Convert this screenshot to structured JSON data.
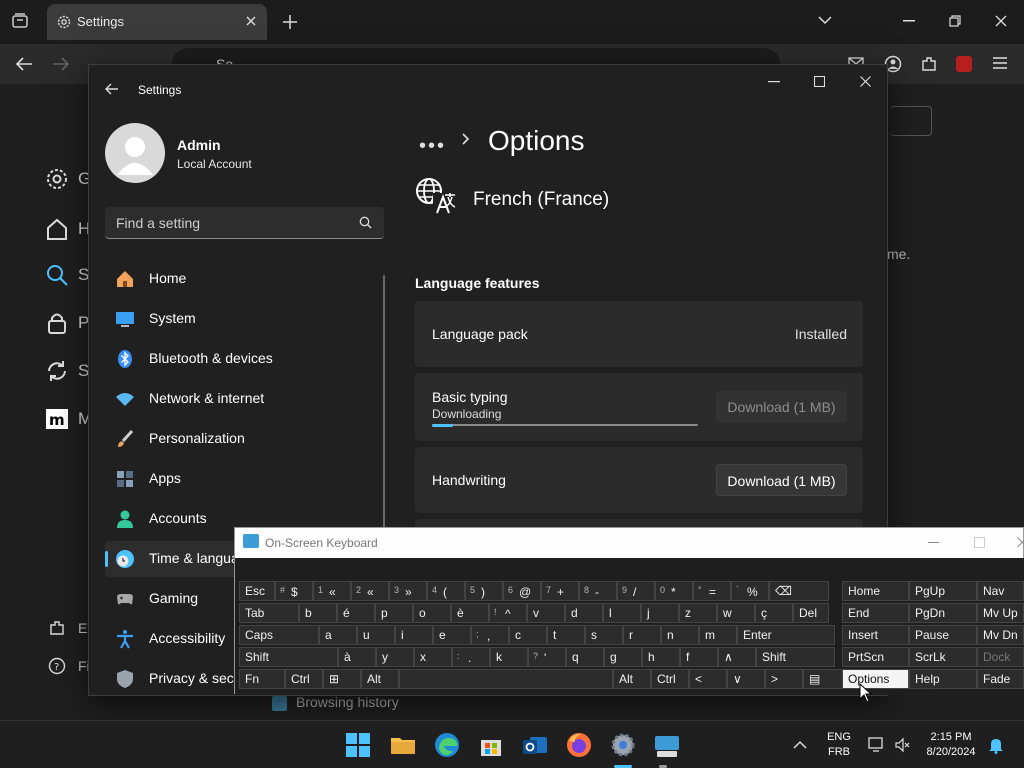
{
  "browser": {
    "tab_title": "Settings",
    "address_text": "Se",
    "bg_nav": [
      {
        "icon": "gear-icon",
        "label": "G"
      },
      {
        "icon": "home-icon",
        "label": "H"
      },
      {
        "icon": "search-icon",
        "label": "S"
      },
      {
        "icon": "lock-icon",
        "label": "P"
      },
      {
        "icon": "sync-icon",
        "label": "S"
      },
      {
        "icon": "m-logo-icon",
        "label": "M"
      }
    ],
    "bg_bottom": [
      {
        "icon": "extensions-icon",
        "label": "Ex"
      },
      {
        "icon": "help-icon",
        "label": "Fi"
      }
    ],
    "bg_partial_text": "me.",
    "bg_checkbox_label": "Browsing history"
  },
  "settings": {
    "window_title": "Settings",
    "user": {
      "name": "Admin",
      "type": "Local Account"
    },
    "search_placeholder": "Find a setting",
    "nav": [
      {
        "label": "Home",
        "icon": "home-icon",
        "color": "#f2a35b",
        "selected": false
      },
      {
        "label": "System",
        "icon": "monitor-icon",
        "color": "#3aa0f3",
        "selected": false
      },
      {
        "label": "Bluetooth & devices",
        "icon": "bluetooth-icon",
        "color": "#3a8ef3",
        "selected": false
      },
      {
        "label": "Network & internet",
        "icon": "wifi-icon",
        "color": "#5ab8f5",
        "selected": false
      },
      {
        "label": "Personalization",
        "icon": "brush-icon",
        "color": "#e8a260",
        "selected": false
      },
      {
        "label": "Apps",
        "icon": "apps-icon",
        "color": "#8aa0b8",
        "selected": false
      },
      {
        "label": "Accounts",
        "icon": "person-icon",
        "color": "#35c79a",
        "selected": false
      },
      {
        "label": "Time & language",
        "icon": "clock-globe-icon",
        "color": "#4cc2ff",
        "selected": true
      },
      {
        "label": "Gaming",
        "icon": "gamepad-icon",
        "color": "#a7a7a7",
        "selected": false
      },
      {
        "label": "Accessibility",
        "icon": "accessibility-icon",
        "color": "#3a9ff5",
        "selected": false
      },
      {
        "label": "Privacy & security",
        "icon": "shield-icon",
        "color": "#9ba3ad",
        "selected": false
      }
    ],
    "breadcrumb_dots": "•••",
    "page_title": "Options",
    "language_name": "French (France)",
    "section_header": "Language features",
    "cards": {
      "language_pack": {
        "label": "Language pack",
        "status": "Installed"
      },
      "basic_typing": {
        "label": "Basic typing",
        "sublabel": "Downloading",
        "progress": 0.08,
        "button": "Download (1 MB)"
      },
      "handwriting": {
        "label": "Handwriting",
        "button": "Download (1 MB)"
      }
    }
  },
  "osk": {
    "title": "On-Screen Keyboard",
    "rows": [
      [
        {
          "m": "Esc"
        },
        {
          "s": "#",
          "m": "$"
        },
        {
          "s": "1",
          "m": "«"
        },
        {
          "s": "2",
          "m": "«"
        },
        {
          "s": "3",
          "m": "»"
        },
        {
          "s": "4",
          "m": "("
        },
        {
          "s": "5",
          "m": ")"
        },
        {
          "s": "6",
          "m": "@"
        },
        {
          "s": "7",
          "m": "+"
        },
        {
          "s": "8",
          "m": "-"
        },
        {
          "s": "9",
          "m": "/"
        },
        {
          "s": "0",
          "m": "*"
        },
        {
          "s": "°",
          "m": "="
        },
        {
          "s": "`",
          "m": "%"
        },
        {
          "m": "⌫"
        }
      ],
      [
        {
          "m": "Tab"
        },
        {
          "m": "b"
        },
        {
          "m": "é"
        },
        {
          "m": "p"
        },
        {
          "m": "o"
        },
        {
          "m": "è"
        },
        {
          "s": "!",
          "m": "^"
        },
        {
          "m": "v"
        },
        {
          "m": "d"
        },
        {
          "m": "l"
        },
        {
          "m": "j"
        },
        {
          "m": "z"
        },
        {
          "m": "w"
        },
        {
          "m": "ç"
        },
        {
          "m": "Del"
        }
      ],
      [
        {
          "m": "Caps"
        },
        {
          "m": "a"
        },
        {
          "m": "u"
        },
        {
          "m": "i"
        },
        {
          "m": "e"
        },
        {
          "s": ";",
          "m": ","
        },
        {
          "m": "c"
        },
        {
          "m": "t"
        },
        {
          "m": "s"
        },
        {
          "m": "r"
        },
        {
          "m": "n"
        },
        {
          "m": "m"
        },
        {
          "m": "Enter"
        }
      ],
      [
        {
          "m": "Shift"
        },
        {
          "m": "à"
        },
        {
          "m": "y"
        },
        {
          "m": "x"
        },
        {
          "s": ":",
          "m": "."
        },
        {
          "m": "k"
        },
        {
          "s": "?",
          "m": "'"
        },
        {
          "m": "q"
        },
        {
          "m": "g"
        },
        {
          "m": "h"
        },
        {
          "m": "f"
        },
        {
          "m": "∧"
        },
        {
          "m": "Shift"
        }
      ],
      [
        {
          "m": "Fn"
        },
        {
          "m": "Ctrl"
        },
        {
          "m": "⊞"
        },
        {
          "m": "Alt"
        },
        {
          "m": ""
        },
        {
          "m": "Alt"
        },
        {
          "m": "Ctrl"
        },
        {
          "m": "<"
        },
        {
          "m": "∨"
        },
        {
          "m": ">"
        },
        {
          "m": "▤"
        }
      ]
    ],
    "right": [
      [
        "Home",
        "PgUp",
        "Nav"
      ],
      [
        "End",
        "PgDn",
        "Mv Up"
      ],
      [
        "Insert",
        "Pause",
        "Mv Dn"
      ],
      [
        "PrtScn",
        "ScrLk",
        "Dock"
      ],
      [
        "Options",
        "Help",
        "Fade"
      ]
    ]
  },
  "taskbar": {
    "lang_top": "ENG",
    "lang_bottom": "FRB",
    "time": "2:15 PM",
    "date": "8/20/2024"
  }
}
